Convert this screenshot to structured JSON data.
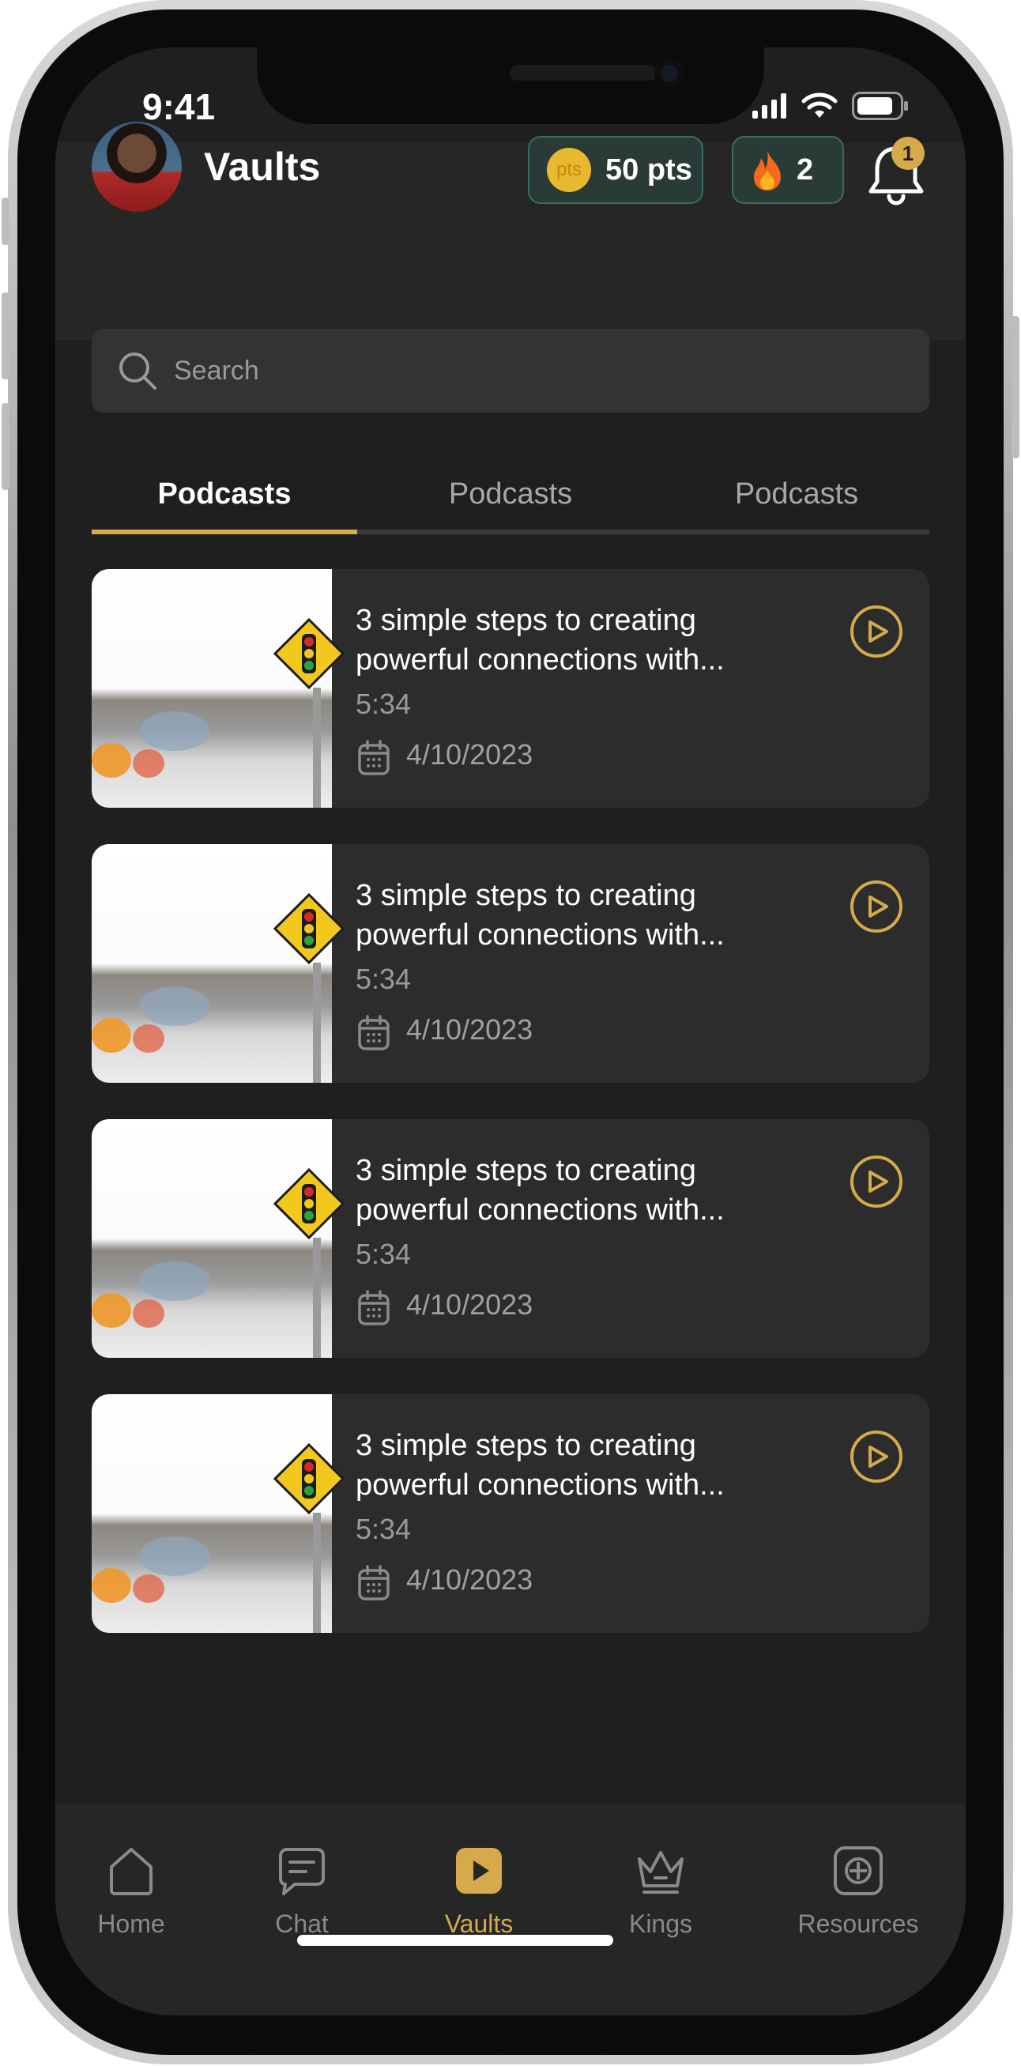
{
  "status_bar": {
    "time": "9:41"
  },
  "header": {
    "title": "Vaults",
    "points": "50 pts",
    "points_icon_text": "pts",
    "streak": "2",
    "notification_count": "1"
  },
  "search": {
    "placeholder": "Search"
  },
  "tabs": [
    {
      "label": "Podcasts",
      "active": true
    },
    {
      "label": "Podcasts",
      "active": false
    },
    {
      "label": "Podcasts",
      "active": false
    }
  ],
  "podcasts": [
    {
      "title": "3 simple steps to creating powerful connections with...",
      "duration": "5:34",
      "date": "4/10/2023"
    },
    {
      "title": "3 simple steps to creating powerful connections with...",
      "duration": "5:34",
      "date": "4/10/2023"
    },
    {
      "title": "3 simple steps to creating powerful connections with...",
      "duration": "5:34",
      "date": "4/10/2023"
    },
    {
      "title": "3 simple steps to creating powerful connections with...",
      "duration": "5:34",
      "date": "4/10/2023"
    }
  ],
  "bottom_nav": [
    {
      "label": "Home",
      "icon": "home-icon",
      "active": false
    },
    {
      "label": "Chat",
      "icon": "chat-icon",
      "active": false
    },
    {
      "label": "Vaults",
      "icon": "play-square-icon",
      "active": true
    },
    {
      "label": "Kings",
      "icon": "crown-icon",
      "active": false
    },
    {
      "label": "Resources",
      "icon": "plus-square-icon",
      "active": false
    }
  ],
  "colors": {
    "accent": "#d6a94b",
    "background": "#1f1f1f",
    "card": "#2c2c2c"
  }
}
